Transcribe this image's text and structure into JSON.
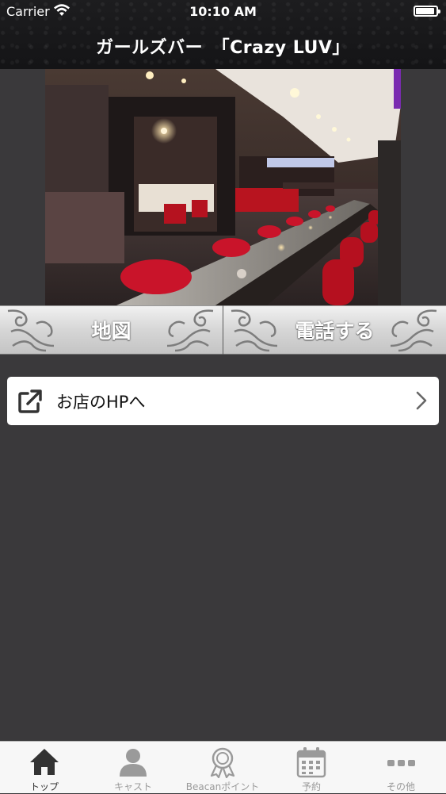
{
  "status_bar": {
    "carrier": "Carrier",
    "time": "10:10 AM"
  },
  "header": {
    "title": "ガールズバー　「Crazy LUV」"
  },
  "actions": {
    "map_label": "地図",
    "call_label": "電話する"
  },
  "homepage_link": {
    "label": "お店のHPへ",
    "icon": "external-link-icon"
  },
  "tabs": [
    {
      "label": "トップ",
      "icon": "home-icon",
      "active": true
    },
    {
      "label": "キャスト",
      "icon": "person-icon",
      "active": false
    },
    {
      "label": "Beacanポイント",
      "icon": "award-ribbon-icon",
      "active": false
    },
    {
      "label": "予約",
      "icon": "calendar-icon",
      "active": false
    },
    {
      "label": "その他",
      "icon": "more-dots-icon",
      "active": false
    }
  ],
  "colors": {
    "background": "#3a393b",
    "header_bg": "#1a1a1c",
    "tab_active": "#333333",
    "tab_inactive": "#9a9a9a",
    "seat_red": "#c9142a"
  }
}
